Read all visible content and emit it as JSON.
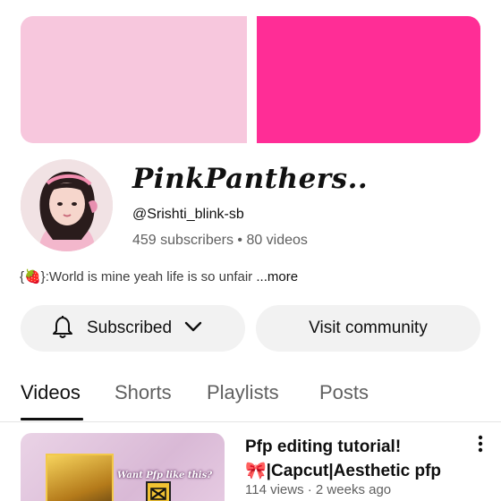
{
  "banner": {
    "left_color": "#f7c7dd",
    "right_color": "#ff2d96"
  },
  "avatar": {
    "icon": "profile-photo"
  },
  "channel": {
    "name": "PinkPanthers..",
    "handle": "@Srishti_blink-sb",
    "stats": "459 subscribers • 80 videos",
    "description": "{🍓}:World is mine yeah life is so unfair",
    "more_label": " ...more"
  },
  "actions": {
    "subscribed_label": "Subscribed",
    "subscribed_icon": "bell-icon",
    "dropdown_icon": "chevron-down-icon",
    "community_label": "Visit community"
  },
  "tabs": [
    {
      "label": "Videos",
      "active": true
    },
    {
      "label": "Shorts",
      "active": false
    },
    {
      "label": "Playlists",
      "active": false
    },
    {
      "label": "Posts",
      "active": false
    }
  ],
  "video": {
    "title": "Pfp editing tutorial!🎀|Capcut|Aesthetic pfp",
    "meta": "114 views · 2 weeks ago",
    "thumbnail_text": "Want Pfp like this?",
    "menu_icon": "more-vert-icon"
  }
}
